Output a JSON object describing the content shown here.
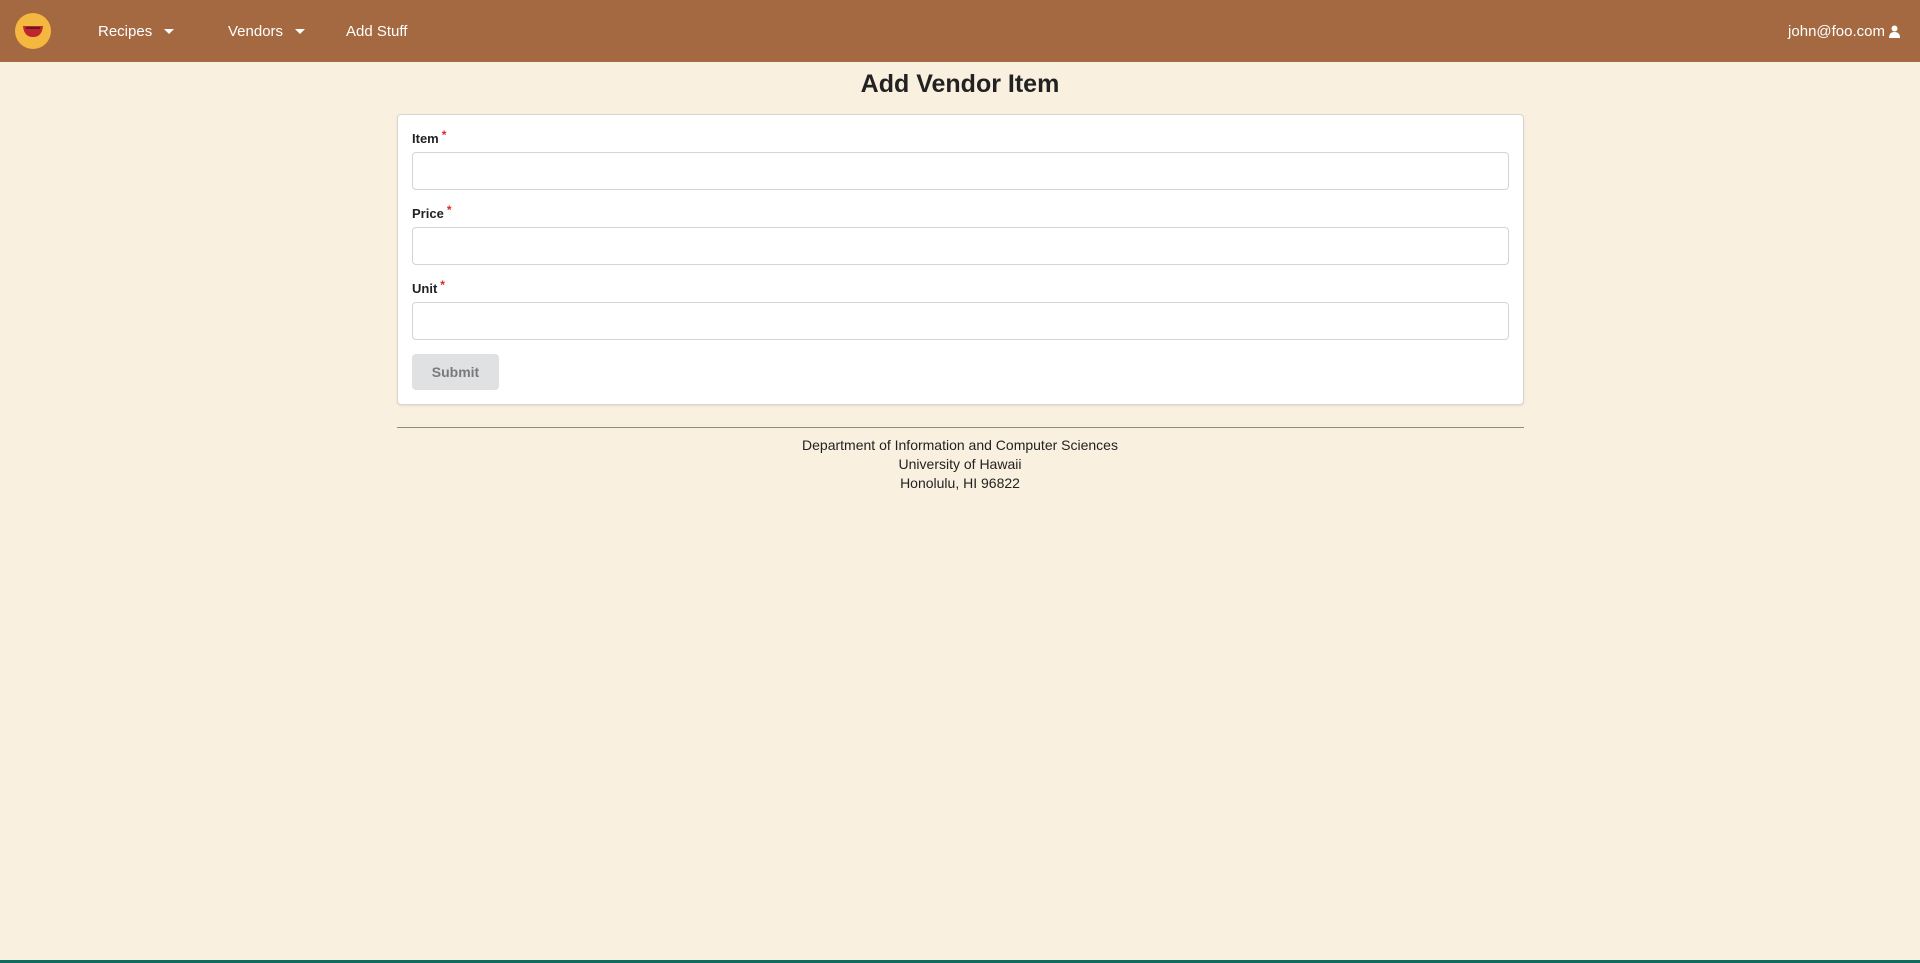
{
  "navbar": {
    "logo_icon": "bowl-logo-icon",
    "recipes_label": "Recipes",
    "vendors_label": "Vendors",
    "add_stuff_label": "Add Stuff",
    "user_email": "john@foo.com",
    "user_icon": "user-icon",
    "background_color": "#a56941"
  },
  "page": {
    "title": "Add Vendor Item"
  },
  "form": {
    "fields": [
      {
        "label": "Item",
        "required_mark": "*",
        "value": ""
      },
      {
        "label": "Price",
        "required_mark": "*",
        "value": ""
      },
      {
        "label": "Unit",
        "required_mark": "*",
        "value": ""
      }
    ],
    "submit_label": "Submit"
  },
  "footer": {
    "line1": "Department of Information and Computer Sciences",
    "line2": "University of Hawaii",
    "line3": "Honolulu, HI 96822"
  }
}
